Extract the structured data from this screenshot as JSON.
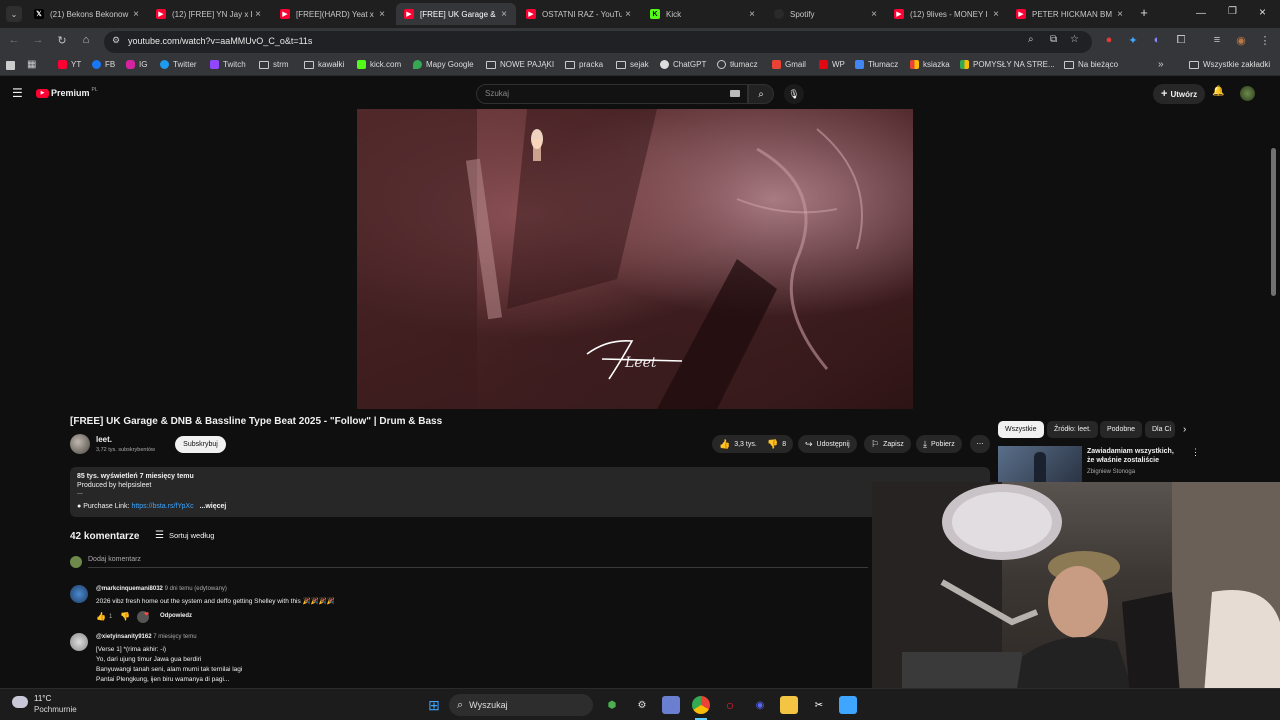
{
  "browser": {
    "tabs": [
      {
        "title": "(21) Bekons Bekonow",
        "icon": "x-logo-icon",
        "color": "#000000"
      },
      {
        "title": "(12) [FREE] YN Jay x L",
        "icon": "youtube-icon",
        "color": "#ff0033"
      },
      {
        "title": "[FREE](HARD) Yeat x L",
        "icon": "youtube-icon",
        "color": "#ff0033"
      },
      {
        "title": "[FREE] UK Garage & I",
        "icon": "youtube-icon",
        "color": "#ff0033",
        "active": true
      },
      {
        "title": "OSTATNI RAZ - YouTu",
        "icon": "youtube-icon",
        "color": "#ff0033"
      },
      {
        "title": "Kick",
        "icon": "kick-icon",
        "color": "#53fc18"
      },
      {
        "title": "Spotify",
        "icon": "spotify-icon",
        "color": "#2a2a2a"
      },
      {
        "title": "(12) 9lives - MONEY I",
        "icon": "youtube-icon",
        "color": "#ff0033"
      },
      {
        "title": "PETER HICKMAN BM",
        "icon": "youtube-icon",
        "color": "#ff0033"
      }
    ],
    "new_tab": "+",
    "url": "youtube.com/watch?v=aaMMUvO_C_o&t=11s",
    "bookmarks": [
      {
        "label": "YT",
        "icon": "youtube-icon"
      },
      {
        "label": "FB",
        "icon": "facebook-icon"
      },
      {
        "label": "IG",
        "icon": "instagram-icon"
      },
      {
        "label": "Twitter",
        "icon": "twitter-icon"
      },
      {
        "label": "Twitch",
        "icon": "twitch-icon"
      },
      {
        "label": "strm",
        "icon": "folder-icon"
      },
      {
        "label": "kawałki",
        "icon": "folder-icon"
      },
      {
        "label": "kick.com",
        "icon": "kick-icon"
      },
      {
        "label": "Mapy Google",
        "icon": "maps-icon"
      },
      {
        "label": "NOWE PAJĄKI",
        "icon": "folder-icon"
      },
      {
        "label": "pracka",
        "icon": "folder-icon"
      },
      {
        "label": "sejak",
        "icon": "folder-icon"
      },
      {
        "label": "ChatGPT",
        "icon": "chatgpt-icon"
      },
      {
        "label": "tłumacz",
        "icon": "globe-icon"
      },
      {
        "label": "Gmail",
        "icon": "gmail-icon"
      },
      {
        "label": "WP",
        "icon": "wp-icon"
      },
      {
        "label": "Tłumacz",
        "icon": "translate-icon"
      },
      {
        "label": "ksiazka",
        "icon": "grid-icon"
      },
      {
        "label": "POMYSŁY NA STRE...",
        "icon": "grid-icon"
      },
      {
        "label": "Na bieżąco",
        "icon": "folder-icon"
      }
    ],
    "all_bookmarks": "Wszystkie zakładki"
  },
  "youtube": {
    "logo": "Premium",
    "logo_region": "PL",
    "search_placeholder": "Szukaj",
    "create_label": "Utwórz",
    "video": {
      "title": "[FREE] UK Garage & DNB & Bassline Type Beat 2025 - \"Follow\" | Drum & Bass",
      "channel": "leet.",
      "subscribers": "3,72 tys. subskrybentów",
      "subscribe_label": "Subskrybuj",
      "likes": "3,3 tys.",
      "dislikes": "8",
      "share": "Udostępnij",
      "save": "Zapisz",
      "download": "Pobierz",
      "watermark": "Leet"
    },
    "description": {
      "stats": "85 tys. wyświetleń  7 miesięcy temu",
      "line2": "Produced by helpsisleet",
      "line3": "...",
      "purchase_label": "Purchase Link:",
      "purchase_link": "https://bsta.rs/fYpXc",
      "more": "...więcej"
    },
    "comments": {
      "count": "42 komentarze",
      "sort": "Sortuj według",
      "add": "Dodaj komentarz",
      "items": [
        {
          "handle": "@markcinquemani8032",
          "time": "9 dni temu (edytowany)",
          "text": "2026 vibz fresh home out the system and deffo getting Shelley with this 🎉🎉🎉🎉",
          "likes": "1",
          "reply": "Odpowiedz"
        },
        {
          "handle": "@xietyinsanity9162",
          "time": "7 miesięcy temu",
          "lines": [
            "[Verse 1] *(rima akhir: -i)",
            "Yo, dari ujung timur Jawa gua berdiri",
            "Banyuwangi tanah seni, alam murni tak ternilai lagi",
            "Pantai Plengkung, ijen biru wamanya di pagi..."
          ]
        }
      ]
    },
    "sidebar": {
      "chips": [
        "Wszystkie",
        "Źródło: leet.",
        "Podobne",
        "Dla Ci"
      ],
      "rec_title": "Zawiadamiam wszystkich, że właśnie zostaliście okradzeni ...",
      "rec_channel": "Zbigniew Stonoga"
    }
  },
  "taskbar": {
    "weather_temp": "11°C",
    "weather_desc": "Pochmurnie",
    "search": "Wyszukaj"
  }
}
